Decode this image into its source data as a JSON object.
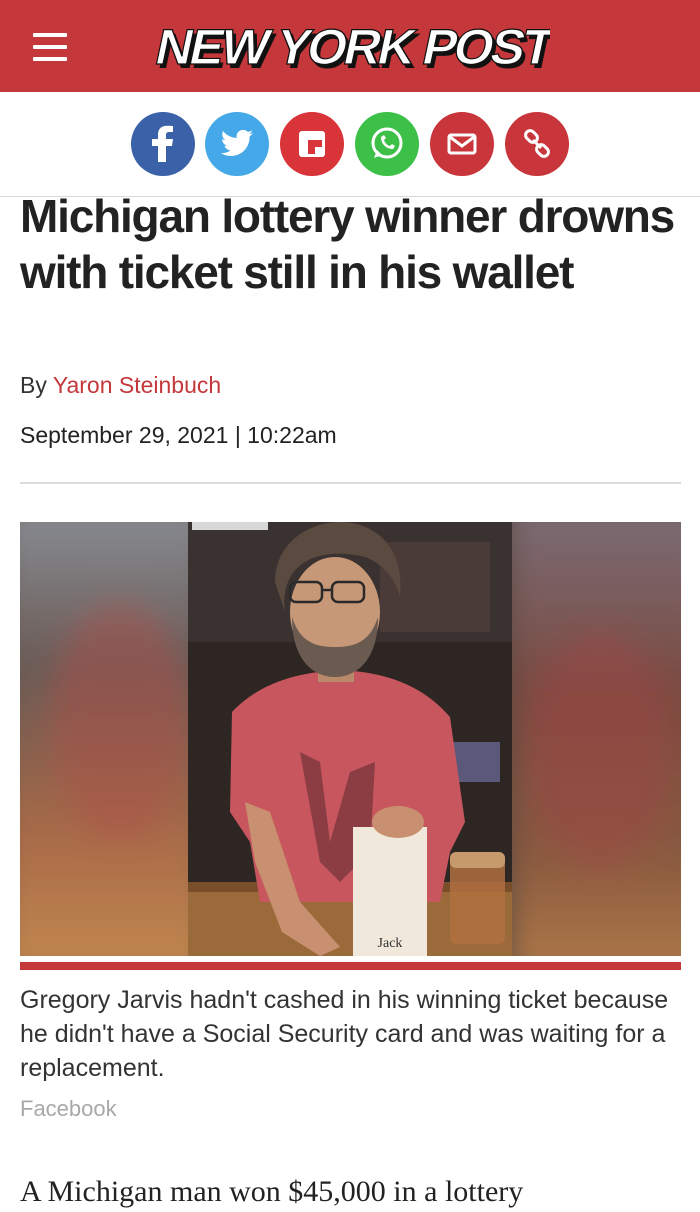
{
  "header": {
    "logo_text": "NEW YORK POST",
    "menu_icon": "hamburger-menu-icon",
    "background_color": "#c4373a"
  },
  "share": {
    "buttons": [
      {
        "name": "facebook",
        "icon": "facebook-icon",
        "color": "#3b62a8"
      },
      {
        "name": "twitter",
        "icon": "twitter-icon",
        "color": "#45a8e8"
      },
      {
        "name": "flipboard",
        "icon": "flipboard-icon",
        "color": "#d8343a"
      },
      {
        "name": "whatsapp",
        "icon": "whatsapp-icon",
        "color": "#3cc048"
      },
      {
        "name": "email",
        "icon": "email-icon",
        "color": "#c8353a"
      },
      {
        "name": "copy-link",
        "icon": "link-icon",
        "color": "#c8353a"
      }
    ]
  },
  "article": {
    "headline": "Michigan lottery winner drowns with ticket still in his wallet",
    "byline_prefix": "By",
    "author": "Yaron Steinbuch",
    "date": "September 29, 2021 | 10:22am",
    "photo_caption": "Gregory Jarvis hadn't cashed in his winning ticket because he didn't have a Social Security card and was waiting for a replacement.",
    "photo_credit": "Facebook",
    "ticket_label": "Jack",
    "body_first_line": "A Michigan man won $45,000 in a lottery"
  }
}
